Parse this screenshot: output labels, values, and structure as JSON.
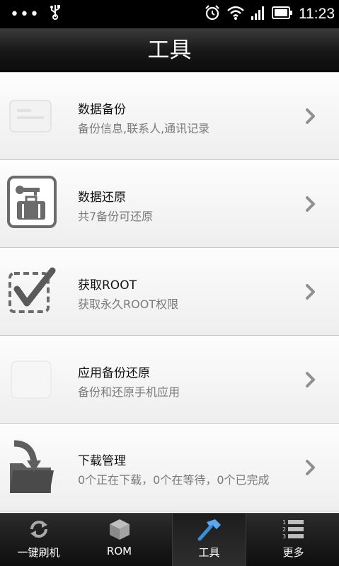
{
  "status_bar": {
    "left_icons": [
      "more-dots-icon",
      "usb-icon"
    ],
    "right_icons": [
      "alarm-icon",
      "wifi-icon",
      "signal-icon",
      "battery-icon"
    ],
    "time": "11:23"
  },
  "header": {
    "title": "工具"
  },
  "tools": [
    {
      "title": "数据备份",
      "subtitle": "备份信息,联系人,通讯记录",
      "icon": "backup-icon"
    },
    {
      "title": "数据还原",
      "subtitle": "共7备份可还原",
      "icon": "restore-icon"
    },
    {
      "title": "获取ROOT",
      "subtitle": "获取永久ROOT权限",
      "icon": "root-check-icon"
    },
    {
      "title": "应用备份还原",
      "subtitle": "备份和还原手机应用",
      "icon": "app-backup-icon"
    },
    {
      "title": "下载管理",
      "subtitle": "0个正在下载，0个在等待，0个已完成",
      "icon": "download-folder-icon"
    }
  ],
  "tab_bar": {
    "tabs": [
      {
        "label": "一键刷机",
        "icon": "refresh-icon"
      },
      {
        "label": "ROM",
        "icon": "box-icon"
      },
      {
        "label": "工具",
        "icon": "hammer-icon",
        "active": true
      },
      {
        "label": "更多",
        "icon": "list-icon"
      }
    ]
  },
  "colors": {
    "title_bar": "#171717",
    "tab_bar": "#1a1a1a",
    "hammer_blue": "#3a8fd8"
  }
}
